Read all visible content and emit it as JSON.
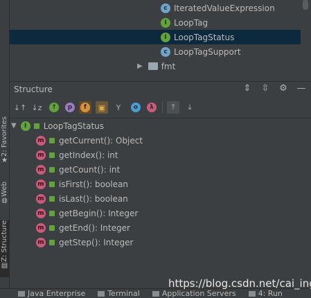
{
  "tree_top": {
    "items": [
      {
        "icon": "class-icon",
        "label": "IteratedValueExpression"
      },
      {
        "icon": "interface-icon",
        "label": "LoopTag"
      },
      {
        "icon": "interface-icon",
        "label": "LoopTagStatus",
        "selected": true
      },
      {
        "icon": "class-icon",
        "label": "LoopTagSupport"
      },
      {
        "icon": "folder-icon",
        "label": "fmt"
      }
    ]
  },
  "side_tabs": {
    "favorites": "2: Favorites",
    "web": "Web",
    "structure": "Z: Structure"
  },
  "structure": {
    "title": "Structure",
    "root": "LoopTagStatus",
    "methods": [
      "getCurrent(): Object",
      "getIndex(): int",
      "getCount(): int",
      "isFirst(): boolean",
      "isLast(): boolean",
      "getBegin(): Integer",
      "getEnd(): Integer",
      "getStep(): Integer"
    ]
  },
  "statusbar": {
    "items": [
      "Java Enterprise",
      "Terminal",
      "Application Servers",
      "4: Run"
    ]
  },
  "watermark": "https://blog.csdn.net/cai_ing"
}
